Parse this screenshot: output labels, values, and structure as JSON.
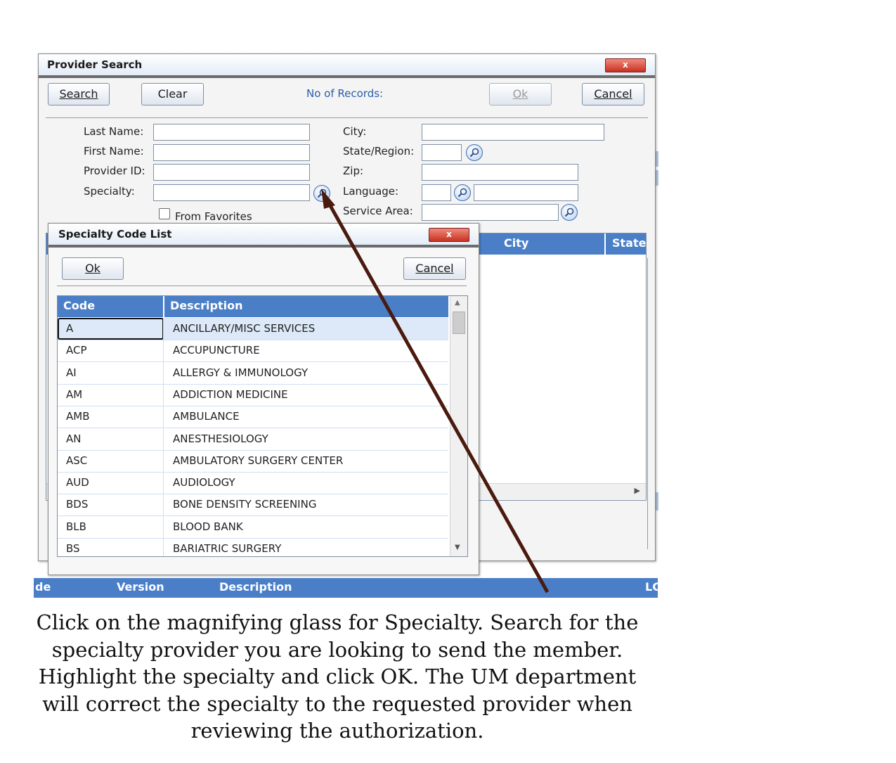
{
  "provider_search": {
    "title": "Provider Search",
    "close_label": "x",
    "search_label": "Search",
    "clear_label": "Clear",
    "records_label": "No of Records:",
    "ok_label": "Ok",
    "cancel_label": "Cancel",
    "fields": {
      "last_name": "Last Name:",
      "first_name": "First Name:",
      "provider_id": "Provider ID:",
      "specialty": "Specialty:",
      "from_favorites": "From Favorites",
      "city": "City:",
      "state_region": "State/Region:",
      "zip": "Zip:",
      "language": "Language:",
      "service_area": "Service Area:"
    },
    "result_columns": {
      "city": "City",
      "state": "State"
    }
  },
  "specialty_list": {
    "title": "Specialty Code List",
    "close_label": "x",
    "ok_label": "Ok",
    "cancel_label": "Cancel",
    "columns": {
      "code": "Code",
      "description": "Description"
    },
    "rows": [
      {
        "code": "A",
        "description": "ANCILLARY/MISC SERVICES"
      },
      {
        "code": "ACP",
        "description": "ACCUPUNCTURE"
      },
      {
        "code": "AI",
        "description": "ALLERGY & IMMUNOLOGY"
      },
      {
        "code": "AM",
        "description": "ADDICTION MEDICINE"
      },
      {
        "code": "AMB",
        "description": "AMBULANCE"
      },
      {
        "code": "AN",
        "description": "ANESTHESIOLOGY"
      },
      {
        "code": "ASC",
        "description": "AMBULATORY SURGERY CENTER"
      },
      {
        "code": "AUD",
        "description": "AUDIOLOGY"
      },
      {
        "code": "BDS",
        "description": "BONE DENSITY SCREENING"
      },
      {
        "code": "BLB",
        "description": "BLOOD BANK"
      },
      {
        "code": "BS",
        "description": "BARIATRIC SURGERY"
      }
    ],
    "selected_index": 0
  },
  "background_grid": {
    "columns": {
      "col1": "de",
      "version": "Version",
      "description": "Description",
      "last": "LC"
    }
  },
  "caption": "Click on the magnifying glass for Specialty. Search for the specialty provider you are looking to send the member. Highlight the specialty and click OK. The UM department will correct the specialty to the requested provider when reviewing the authorization.",
  "colors": {
    "header_blue": "#4a7fc8",
    "link_blue": "#2b5fa8",
    "arrow": "#4a1a0e",
    "close_red": "#c9311f"
  }
}
